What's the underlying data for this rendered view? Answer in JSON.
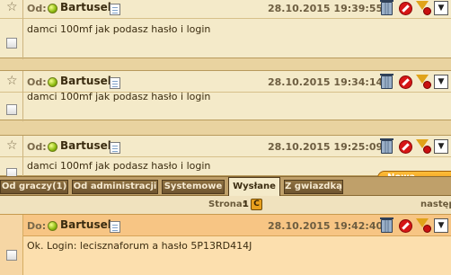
{
  "messages": [
    {
      "from_label": "Od:",
      "username": "Bartusek",
      "datetime": "28.10.2015 19:39:55",
      "body": "damci 100mf jak podasz hasło i login"
    },
    {
      "from_label": "Od:",
      "username": "Bartusek",
      "datetime": "28.10.2015 19:34:14",
      "body": "damci 100mf jak podasz hasło i login"
    },
    {
      "from_label": "Od:",
      "username": "Bartusek",
      "datetime": "28.10.2015 19:25:09",
      "body": "damci 100mf jak podasz hasło i login"
    }
  ],
  "tabs": [
    {
      "label": "Od graczy(1)"
    },
    {
      "label": "Od administracji"
    },
    {
      "label": "Systemowe"
    },
    {
      "label": "Wysłane",
      "active": true
    },
    {
      "label": "Z gwiazdką"
    }
  ],
  "new_message_button": "Nowa wiadomo",
  "pager": {
    "label": "Strona:",
    "page": "1",
    "next": "następ"
  },
  "sent_message": {
    "to_label": "Do:",
    "username": "Bartusek",
    "datetime": "28.10.2015 19:42:40",
    "body": "Ok. Login: lecisznaforum a hasło 5P13RD414J"
  },
  "icons": {
    "online": "online-status-icon",
    "note": "note-icon",
    "trash": "trash-icon",
    "block": "block-icon",
    "filter": "filter-icon",
    "menu": "chevron-down-icon",
    "refresh": "refresh-icon"
  },
  "colors": {
    "accent_orange": "#e59010",
    "panel_bg": "#f4eac9",
    "sent_bg": "#fcdfae",
    "tab_bg": "#6e5430"
  }
}
